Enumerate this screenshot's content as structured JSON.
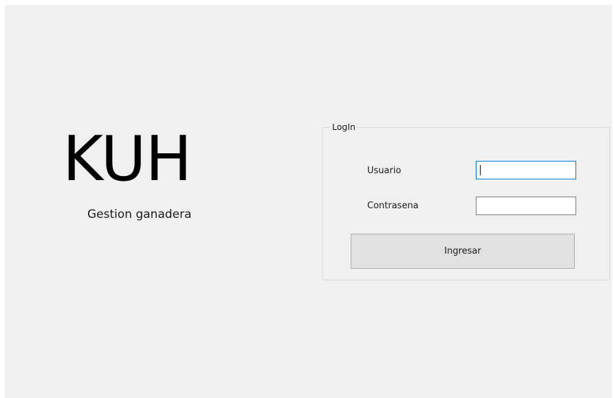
{
  "branding": {
    "title": "KUH",
    "subtitle": "Gestion ganadera"
  },
  "login": {
    "legend": "LogIn",
    "username_label": "Usuario",
    "username_value": "",
    "password_label": "Contrasena",
    "password_value": "",
    "submit_label": "Ingresar"
  },
  "colors": {
    "window_background": "#f0f0f0",
    "button_background": "#e1e1e1",
    "focus_border": "#0078d7"
  }
}
